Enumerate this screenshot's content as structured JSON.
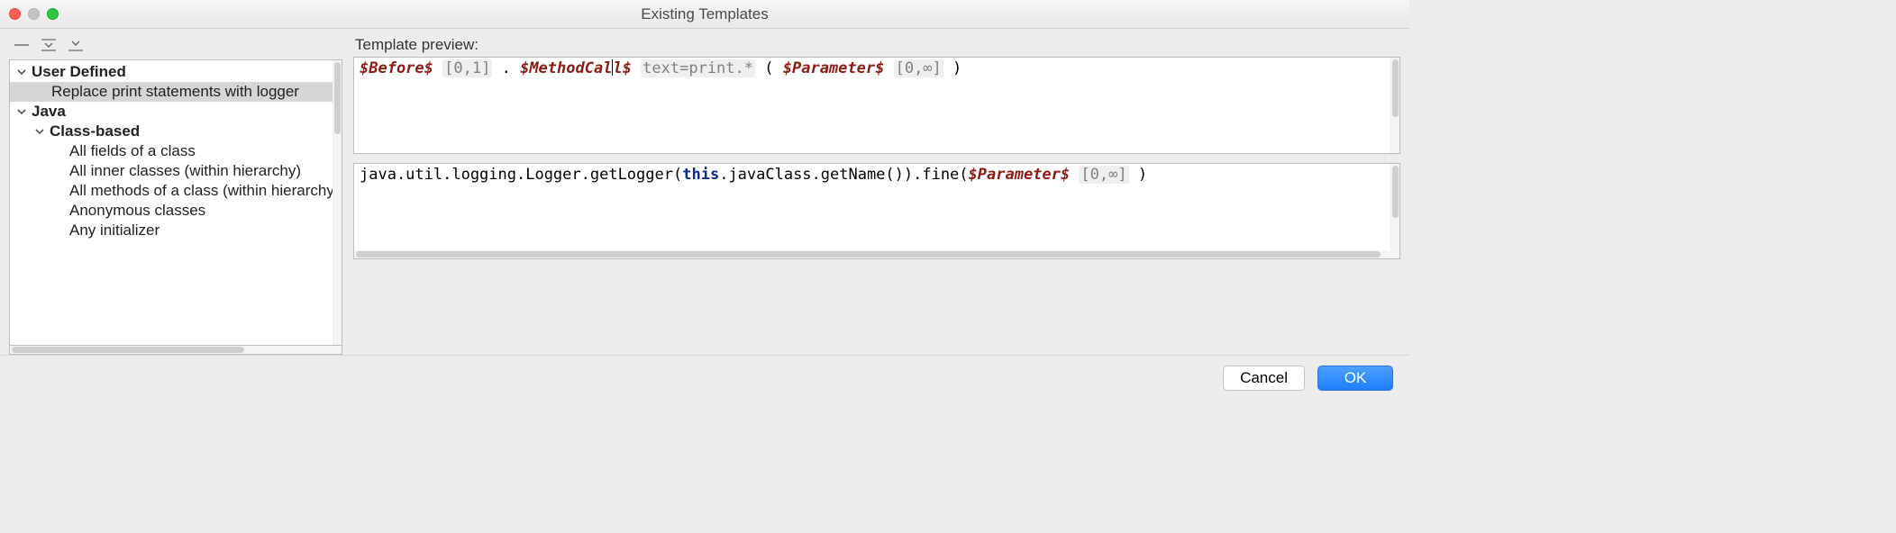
{
  "window": {
    "title": "Existing Templates"
  },
  "toolbar": {
    "collapse_all": "collapse",
    "expand_all": "expand",
    "expand_selected": "expand-selected"
  },
  "tree": {
    "user_defined": {
      "label": "User Defined"
    },
    "user_defined_items": [
      {
        "label": "Replace print statements with logger"
      }
    ],
    "java": {
      "label": "Java"
    },
    "class_based": {
      "label": "Class-based"
    },
    "class_based_items": [
      {
        "label": "All fields of a class"
      },
      {
        "label": "All inner classes (within hierarchy)"
      },
      {
        "label": "All methods of a class (within hierarchy)"
      },
      {
        "label": "Anonymous classes"
      },
      {
        "label": "Any initializer"
      }
    ]
  },
  "preview": {
    "label": "Template preview:",
    "search": {
      "before_var": "$Before$",
      "before_hint": "[0,1]",
      "dot": " .",
      "method_left": "$MethodCal",
      "method_right": "l$",
      "method_hint": "text=print.*",
      "open": " (",
      "param_var": "$Parameter$",
      "param_hint": "[0,∞]",
      "close": " )"
    },
    "replace": {
      "prefix": "java.util.logging.Logger.getLogger(",
      "kw": "this",
      "mid": ".javaClass.getName()).fine(",
      "param_var": "$Parameter$",
      "param_hint": "[0,∞]",
      "close": " )"
    }
  },
  "footer": {
    "cancel": "Cancel",
    "ok": "OK"
  }
}
